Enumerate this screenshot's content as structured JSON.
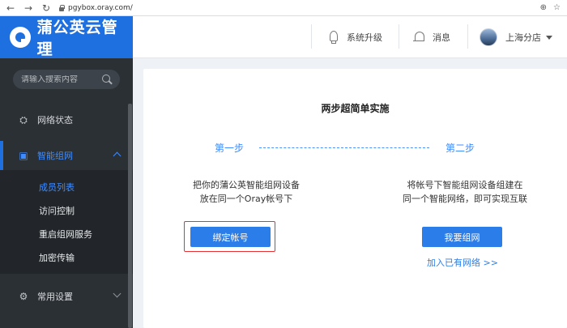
{
  "browser": {
    "url": "pgybox.oray.com/",
    "back": "←",
    "forward": "→",
    "reload": "↻",
    "zoom_icon": "⊕",
    "star_icon": "☆"
  },
  "sidebar": {
    "brand": "蒲公英云管理",
    "search_placeholder": "请输入搜索内容",
    "items": [
      {
        "label": "网络状态",
        "icon": "⛭"
      },
      {
        "label": "智能组网",
        "icon": "▣"
      },
      {
        "label": "常用设置",
        "icon": "⚙"
      }
    ],
    "submenu": [
      "成员列表",
      "访问控制",
      "重启组网服务",
      "加密传输"
    ]
  },
  "topbar": {
    "upgrade": "系统升级",
    "messages": "消息",
    "user": "上海分店"
  },
  "main": {
    "title": "两步超简单实施",
    "step1": {
      "label": "第一步",
      "line1": "把你的蒲公英智能组网设备",
      "line2": "放在同一个Oray帐号下",
      "button": "绑定帐号"
    },
    "step2": {
      "label": "第二步",
      "line1": "将帐号下智能组网设备组建在",
      "line2": "同一个智能网络，即可实现互联",
      "button": "我要组网",
      "link": "加入已有网络 >>"
    }
  },
  "colors": {
    "accent": "#2b7de9",
    "brand_bg": "#1e6fe0",
    "sidebar_bg": "#2b3035",
    "highlight": "#e63232"
  }
}
